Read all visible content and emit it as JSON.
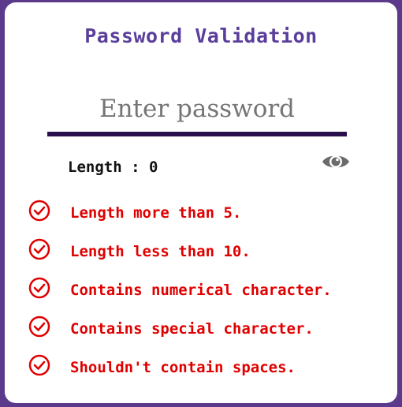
{
  "title": "Password Validation",
  "password": {
    "placeholder": "Enter password",
    "value": ""
  },
  "length": {
    "label": "Length",
    "separator": ":",
    "value": "0"
  },
  "toggle_visibility_icon": "eye-icon",
  "colors": {
    "frame": "#5b3a8c",
    "title": "#5a3e9b",
    "underline": "#2a0f4d",
    "rule_invalid": "#e00000"
  },
  "rules": [
    {
      "text": "Length more than 5.",
      "icon": "check-circle-icon",
      "valid": false
    },
    {
      "text": "Length less than 10.",
      "icon": "check-circle-icon",
      "valid": false
    },
    {
      "text": "Contains numerical character.",
      "icon": "check-circle-icon",
      "valid": false
    },
    {
      "text": "Contains special character.",
      "icon": "check-circle-icon",
      "valid": false
    },
    {
      "text": "Shouldn't contain spaces.",
      "icon": "check-circle-icon",
      "valid": false
    }
  ]
}
